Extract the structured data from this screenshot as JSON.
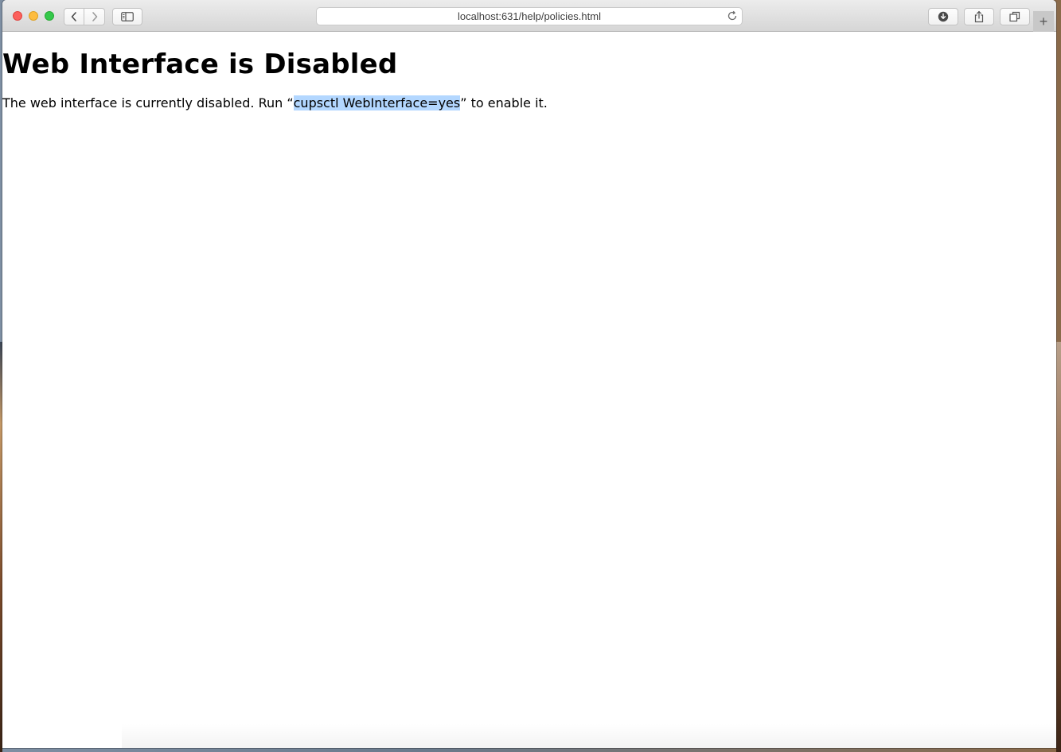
{
  "browser": {
    "url": "localhost:631/help/policies.html",
    "new_tab_glyph": "+",
    "icons": {
      "back": "chevron-left-icon",
      "forward": "chevron-right-icon",
      "sidebar": "sidebar-icon",
      "reload": "reload-icon",
      "download": "download-icon",
      "share": "share-icon",
      "tabs": "tabs-overview-icon"
    }
  },
  "page": {
    "title": "Web Interface is Disabled",
    "message_before": "The web interface is currently disabled. Run “",
    "command": "cupsctl WebInterface=yes",
    "message_after": "” to enable it."
  },
  "colors": {
    "selection_highlight": "#b3d7ff",
    "close": "#fc605c",
    "minimize": "#fdbc40",
    "maximize": "#34c84a"
  }
}
